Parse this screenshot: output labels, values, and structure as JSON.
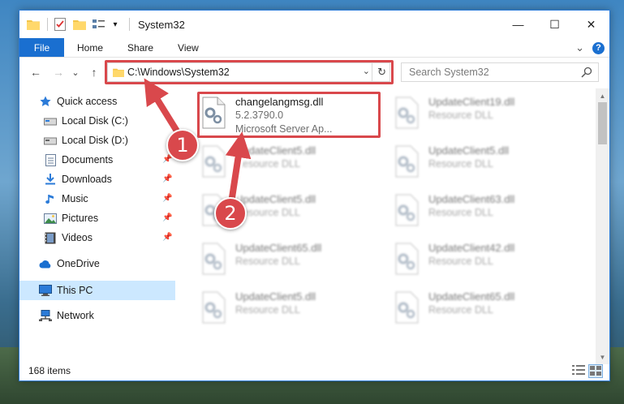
{
  "window": {
    "title": "System32",
    "controls": {
      "minimize": "—",
      "maximize": "☐",
      "close": "✕"
    }
  },
  "ribbon": {
    "tabs": [
      "File",
      "Home",
      "Share",
      "View"
    ],
    "expand_glyph": "⌄",
    "help_glyph": "?"
  },
  "nav": {
    "back": "←",
    "forward": "→",
    "recent": "⌄",
    "up": "↑",
    "address": "C:\\Windows\\System32",
    "address_dropdown": "⌄",
    "refresh": "↻",
    "search_placeholder": "Search System32"
  },
  "sidebar": {
    "items": [
      {
        "label": "Quick access",
        "icon": "star-icon",
        "pinned": false
      },
      {
        "label": "Local Disk (C:)",
        "icon": "drive-icon",
        "pinned": false
      },
      {
        "label": "Local Disk (D:)",
        "icon": "drive-icon",
        "pinned": false
      },
      {
        "label": "Documents",
        "icon": "documents-icon",
        "pinned": true
      },
      {
        "label": "Downloads",
        "icon": "download-icon",
        "pinned": true
      },
      {
        "label": "Music",
        "icon": "music-icon",
        "pinned": true
      },
      {
        "label": "Pictures",
        "icon": "pictures-icon",
        "pinned": true
      },
      {
        "label": "Videos",
        "icon": "video-icon",
        "pinned": true
      },
      {
        "label": "OneDrive",
        "icon": "cloud-icon",
        "pinned": false
      },
      {
        "label": "This PC",
        "icon": "computer-icon",
        "pinned": false,
        "selected": true
      },
      {
        "label": "Network",
        "icon": "network-icon",
        "pinned": false
      }
    ],
    "pin_glyph": "📌"
  },
  "files": [
    {
      "name": "changelangmsg.dll",
      "line2": "5.2.3790.0",
      "line3": "Microsoft Server Ap...",
      "highlighted": true
    },
    {
      "name": "UpdateClient19.dll",
      "line2": "Resource DLL"
    },
    {
      "name": "UpdateClient5.dll",
      "line2": "Resource DLL"
    },
    {
      "name": "UpdateClient5.dll",
      "line2": "Resource DLL"
    },
    {
      "name": "UpdateClient5.dll",
      "line2": "Resource DLL"
    },
    {
      "name": "UpdateClient63.dll",
      "line2": "Resource DLL"
    },
    {
      "name": "UpdateClient65.dll",
      "line2": "Resource DLL"
    },
    {
      "name": "UpdateClient42.dll",
      "line2": "Resource DLL"
    },
    {
      "name": "UpdateClient5.dll",
      "line2": "Resource DLL"
    },
    {
      "name": "UpdateClient65.dll",
      "line2": "Resource DLL"
    }
  ],
  "status": {
    "item_count": "168 items"
  },
  "annotations": [
    {
      "number": "1"
    },
    {
      "number": "2"
    }
  ],
  "colors": {
    "accent": "#1a6fd0",
    "highlight_red": "#d9484c",
    "selected_bg": "#cce8ff"
  }
}
